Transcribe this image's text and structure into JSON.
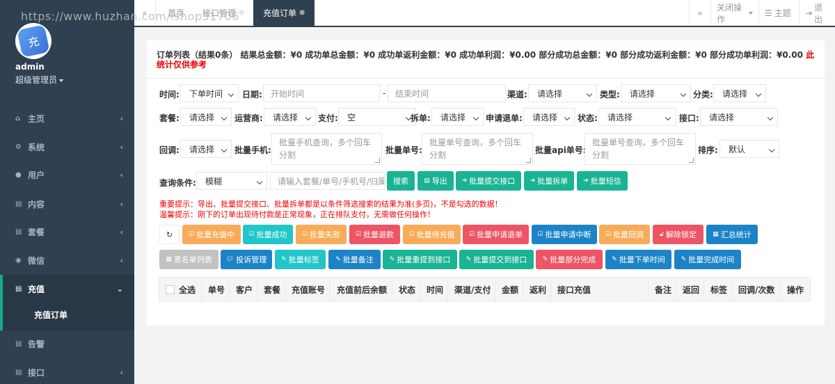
{
  "watermark": "https://www.huzhan.com/ishop51706",
  "sidebar": {
    "admin_name": "admin",
    "admin_role": "超级管理员",
    "avatar_text": "充",
    "items": [
      {
        "label": "主页",
        "icon": "home-icon"
      },
      {
        "label": "系统",
        "icon": "cogs-icon"
      },
      {
        "label": "用户",
        "icon": "users-icon"
      },
      {
        "label": "内容",
        "icon": "file-icon"
      },
      {
        "label": "套餐",
        "icon": "file-icon"
      },
      {
        "label": "微信",
        "icon": "wechat-icon"
      },
      {
        "label": "充值",
        "icon": "file-icon"
      },
      {
        "label": "告警",
        "icon": "file-icon"
      },
      {
        "label": "接口",
        "icon": "file-icon"
      }
    ],
    "sub_item": "充值订单"
  },
  "topbar": {
    "tabs": [
      {
        "label": "首页"
      },
      {
        "label": "接口管理"
      },
      {
        "label": "充值订单"
      }
    ],
    "close_ops": "关闭操作",
    "theme": "主题",
    "logout": "退出"
  },
  "summary": {
    "text": "订单列表（结果0条） 结果总金额：¥0  成功单总金额：¥0 成功单返利金额：¥0  成功单利润：¥0.00 部分成功总金额：¥0 部分成功返利金额：¥0 部分成功单利润：¥0.00",
    "note": "此统计仅供参考"
  },
  "filters": {
    "time_label": "时间:",
    "time_value": "下单时间",
    "date_label": "日期:",
    "start_placeholder": "开始时间",
    "dash": "-",
    "end_placeholder": "结束时间",
    "channel_label": "渠道:",
    "type_label": "类型:",
    "category_label": "分类:",
    "please_select": "请选择",
    "package_label": "套餐:",
    "operator_label": "运营商:",
    "pay_label": "支付:",
    "pay_value": "空",
    "split_label": "拆单:",
    "refund_label": "申请退单:",
    "status_label": "状态:",
    "api_label": "接口:",
    "callback_label": "回调:",
    "batch_phone_label": "批量手机:",
    "batch_phone_placeholder": "批量手机查询，多个回车分割",
    "batch_order_label": "批量单号:",
    "batch_order_placeholder": "批量单号查询，多个回车分割",
    "batch_api_label": "批量api单号:",
    "batch_api_placeholder": "批量单号查询，多个回车分割",
    "sort_label": "排序:",
    "sort_value": "默认",
    "query_label": "查询条件:",
    "query_value": "模糊",
    "query_placeholder": "请输入套餐/单号/手机号/归属地"
  },
  "action_buttons": {
    "search": "搜索",
    "export": "导出",
    "batch_submit_api": "批量提交接口",
    "batch_split": "批量拆单",
    "batch_sms": "批量短信"
  },
  "notices": {
    "important": "重要提示：导出、批量提交接口、批量拆单都是以条件筛选搜索的结果为准(多页)，不是勾选的数据！",
    "warm": "温馨提示：刚下的订单出现待付款是正常现象，正在排队支付，无需做任何操作！"
  },
  "batch_row1": [
    {
      "label": "批量充值中",
      "color": "o"
    },
    {
      "label": "批量成功",
      "color": "t"
    },
    {
      "label": "批量失败",
      "color": "o"
    },
    {
      "label": "批量退款",
      "color": "r"
    },
    {
      "label": "批量待充值",
      "color": "o"
    },
    {
      "label": "批量申请退单",
      "color": "r"
    },
    {
      "label": "批量申请中断",
      "color": "b"
    },
    {
      "label": "批量回调",
      "color": "o"
    },
    {
      "label": "解除锁定",
      "color": "r"
    },
    {
      "label": "汇总统计",
      "color": "b"
    }
  ],
  "batch_row2": [
    {
      "label": "黑名单列表",
      "color": "gr"
    },
    {
      "label": "投诉管理",
      "color": "b"
    },
    {
      "label": "批量标签",
      "color": "t"
    },
    {
      "label": "批量备注",
      "color": "b"
    },
    {
      "label": "批量重提到接口",
      "color": "g"
    },
    {
      "label": "批量提交到接口",
      "color": "g"
    },
    {
      "label": "批量部分完成",
      "color": "r"
    },
    {
      "label": "批量下单时间",
      "color": "b"
    },
    {
      "label": "批量完成时间",
      "color": "b"
    }
  ],
  "table": {
    "headers": [
      "全选",
      "单号",
      "客户",
      "套餐",
      "充值账号",
      "充值前后余额",
      "状态",
      "时间",
      "渠道/支付",
      "金额",
      "返利",
      "接口充值",
      "备注",
      "返回",
      "标签",
      "回调/次数",
      "操作"
    ]
  },
  "colors": {
    "sidebar_bg": "#2f4050",
    "accent": "#1ab394",
    "primary": "#1c84c6",
    "warning": "#f8ac59",
    "danger": "#ed5565",
    "info": "#23c6c8"
  }
}
